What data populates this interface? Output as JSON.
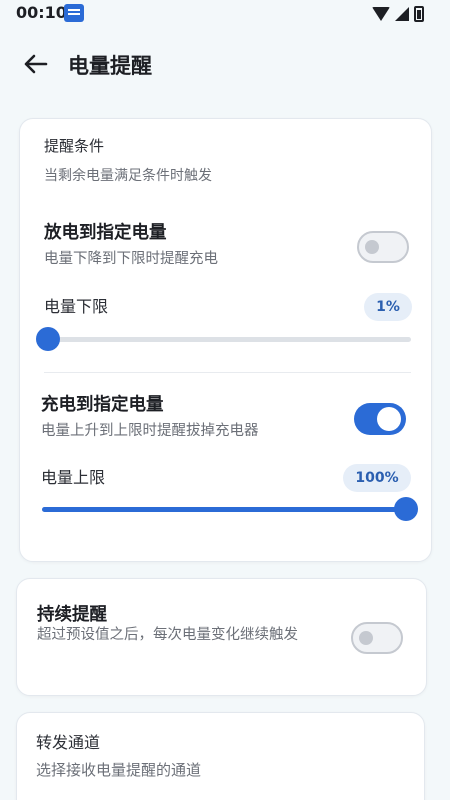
{
  "status_bar": {
    "time": "00:10"
  },
  "header": {
    "title": "电量提醒"
  },
  "conditions": {
    "title": "提醒条件",
    "subtitle": "当剩余电量满足条件时触发",
    "discharge": {
      "title": "放电到指定电量",
      "subtitle": "电量下降到下限时提醒充电",
      "enabled": false,
      "slider_label": "电量下限",
      "value_text": "1%",
      "value": 0.01
    },
    "charge": {
      "title": "充电到指定电量",
      "subtitle": "电量上升到上限时提醒拔掉充电器",
      "enabled": true,
      "slider_label": "电量上限",
      "value_text": "100%",
      "value": 1.0
    }
  },
  "persist": {
    "title": "持续提醒",
    "subtitle": "超过预设值之后，每次电量变化继续触发",
    "enabled": false
  },
  "channel": {
    "title": "转发通道",
    "subtitle": "选择接收电量提醒的通道"
  },
  "colors": {
    "accent": "#2b6bd6",
    "background": "#f3f8fa",
    "card": "#ffffff"
  }
}
